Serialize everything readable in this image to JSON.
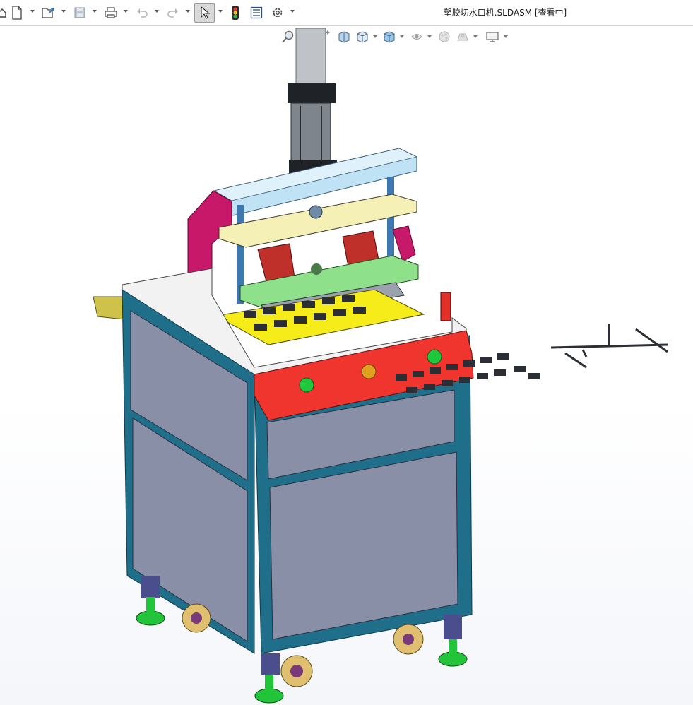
{
  "window": {
    "title": "塑胶切水口机.SLDASM [查看中]"
  },
  "toolbar": {
    "buttons": [
      {
        "name": "home-icon",
        "label": "Home"
      },
      {
        "name": "new-document-icon",
        "label": "New"
      },
      {
        "name": "open-folder-icon",
        "label": "Open"
      },
      {
        "name": "save-icon",
        "label": "Save"
      },
      {
        "name": "print-icon",
        "label": "Print"
      },
      {
        "name": "undo-icon",
        "label": "Undo"
      },
      {
        "name": "redo-icon",
        "label": "Redo"
      },
      {
        "name": "select-pointer-icon",
        "label": "Select"
      },
      {
        "name": "rebuild-traffic-light-icon",
        "label": "Rebuild"
      },
      {
        "name": "file-properties-icon",
        "label": "File Properties"
      },
      {
        "name": "options-gear-icon",
        "label": "Options"
      }
    ]
  },
  "heads_up_toolbar": {
    "buttons": [
      {
        "name": "zoom-to-fit-icon"
      },
      {
        "name": "zoom-to-area-icon"
      },
      {
        "name": "previous-view-icon"
      },
      {
        "name": "section-view-icon"
      },
      {
        "name": "view-orientation-icon"
      },
      {
        "name": "display-style-icon"
      },
      {
        "name": "hide-show-items-icon"
      },
      {
        "name": "edit-appearance-icon"
      },
      {
        "name": "apply-scene-icon"
      },
      {
        "name": "view-settings-icon"
      }
    ]
  },
  "model": {
    "description_colors": {
      "frame": "#1f6f8b",
      "panel": "#8a8fa8",
      "top_plate": "#f2f2f2",
      "control_panel": "#f0342e",
      "upper_plate": "#a8d8f0",
      "middle_plate": "#f4f0b0",
      "lower_plate": "#8ee08a",
      "side_bracket": "#c8186a",
      "fixture": "#f5ec1a",
      "block": "#c0302a",
      "feet": "#22c43a",
      "caster": "#e0c070"
    }
  }
}
